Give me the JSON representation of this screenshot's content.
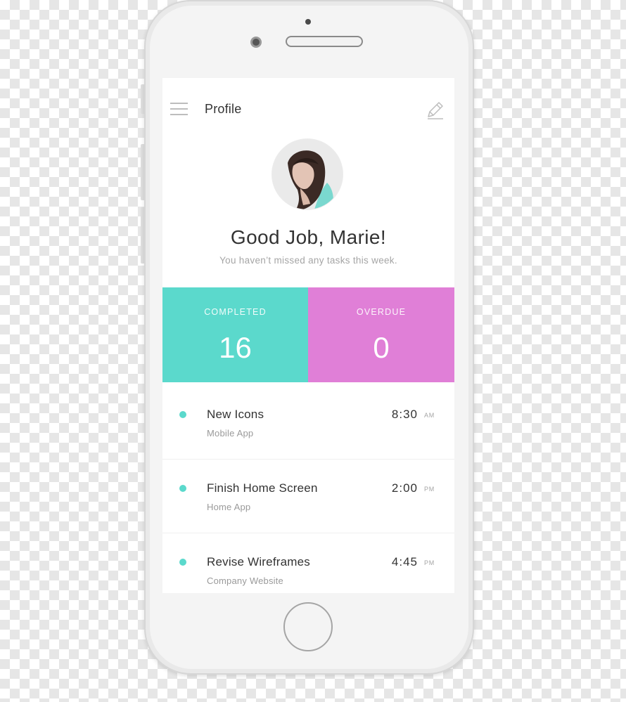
{
  "colors": {
    "completed": "#5bd9cc",
    "overdue": "#e07fd7",
    "dot": "#5bd9cc",
    "frame": "#e9e9e9"
  },
  "header": {
    "title": "Profile",
    "menu_icon": "hamburger-menu-icon",
    "edit_icon": "pencil-icon"
  },
  "profile": {
    "greeting": "Good Job, Marie!",
    "subtitle": "You haven’t missed any tasks this week."
  },
  "stats": {
    "completed": {
      "label": "COMPLETED",
      "value": "16"
    },
    "overdue": {
      "label": "OVERDUE",
      "value": "0"
    }
  },
  "tasks": [
    {
      "title": "New Icons",
      "project": "Mobile App",
      "time": "8:30",
      "ampm": "AM"
    },
    {
      "title": "Finish Home Screen",
      "project": "Home App",
      "time": "2:00",
      "ampm": "PM"
    },
    {
      "title": "Revise Wireframes",
      "project": "Company Website",
      "time": "4:45",
      "ampm": "PM"
    }
  ]
}
